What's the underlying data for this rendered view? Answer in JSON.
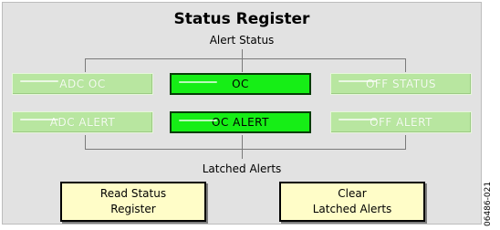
{
  "panel": {
    "title": "Status Register",
    "alert_status_label": "Alert Status",
    "latched_alerts_label": "Latched Alerts"
  },
  "indicators": {
    "adc_oc": {
      "label": "ADC OC",
      "state": "off"
    },
    "oc": {
      "label": "OC",
      "state": "on"
    },
    "off_status": {
      "label": "OFF STATUS",
      "state": "off"
    },
    "adc_alert": {
      "label": "ADC ALERT",
      "state": "off"
    },
    "oc_alert": {
      "label": "OC ALERT",
      "state": "on"
    },
    "off_alert": {
      "label": "OFF ALERT",
      "state": "off"
    }
  },
  "buttons": {
    "read_status_line1": "Read Status",
    "read_status_line2": "Register",
    "clear_latched_line1": "Clear",
    "clear_latched_line2": "Latched Alerts"
  },
  "figure_id": "06486-021",
  "colors": {
    "panel_bg": "#e2e2e2",
    "indicator_on": "#16ee16",
    "indicator_off": "#b8e6a0",
    "button_bg": "#fffdc8"
  }
}
